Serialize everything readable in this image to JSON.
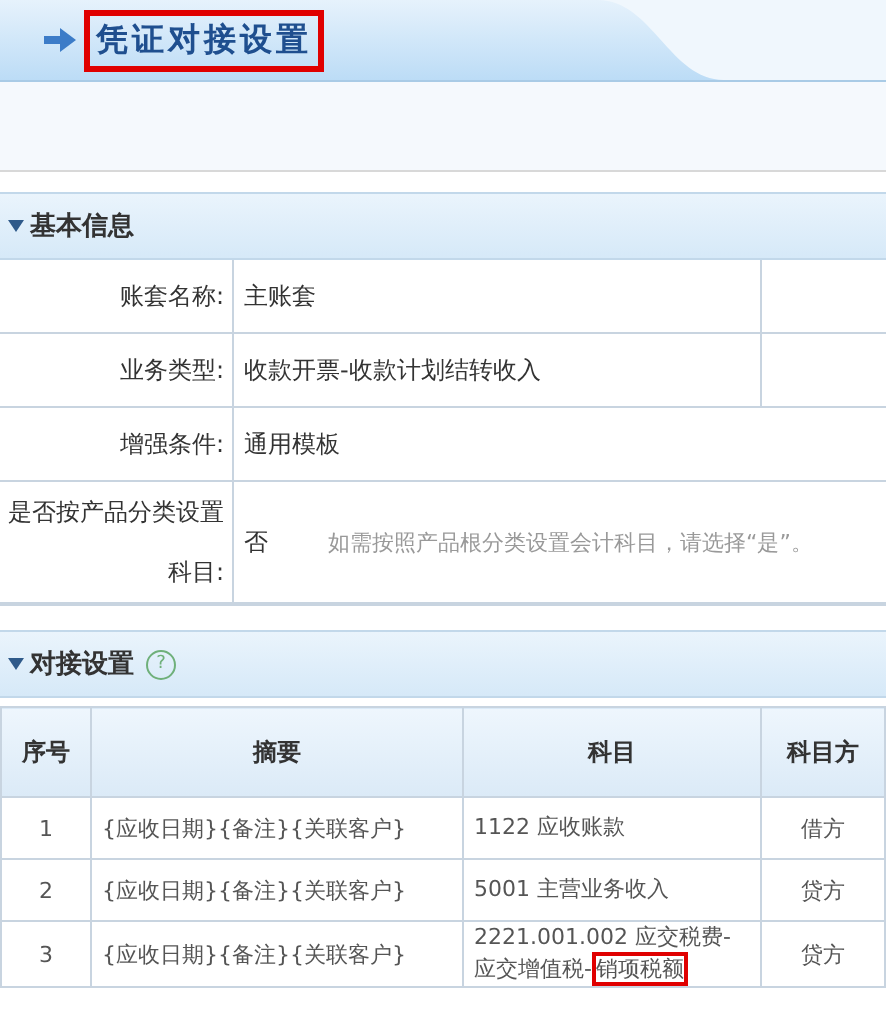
{
  "title": {
    "text": "凭证对接设置",
    "highlighted": true
  },
  "basic_section": {
    "title": "基本信息",
    "expanded": true,
    "rows": [
      {
        "label": "账套名称:",
        "value": "主账套"
      },
      {
        "label": "业务类型:",
        "value": "收款开票-收款计划结转收入"
      },
      {
        "label": "增强条件:",
        "value": "通用模板"
      },
      {
        "label": "是否按产品分类设置科目:",
        "value": "否",
        "hint": "如需按照产品根分类设置会计科目，请选择“是”。"
      }
    ]
  },
  "link_section": {
    "title": "对接设置",
    "help": "?",
    "expanded": true,
    "columns": [
      "序号",
      "摘要",
      "科目",
      "科目方"
    ],
    "rows": [
      {
        "index": "1",
        "summary": "{应收日期}{备注}{关联客户}",
        "subject": "1122 应收账款",
        "direction": "借方"
      },
      {
        "index": "2",
        "summary": "{应收日期}{备注}{关联客户}",
        "subject": "5001 主营业务收入",
        "direction": "贷方"
      },
      {
        "index": "3",
        "summary": "{应收日期}{备注}{关联客户}",
        "subject": "2221.001.002 应交税费-应交增值税-",
        "subject_marked": "销项税额",
        "direction": "贷方"
      }
    ]
  }
}
